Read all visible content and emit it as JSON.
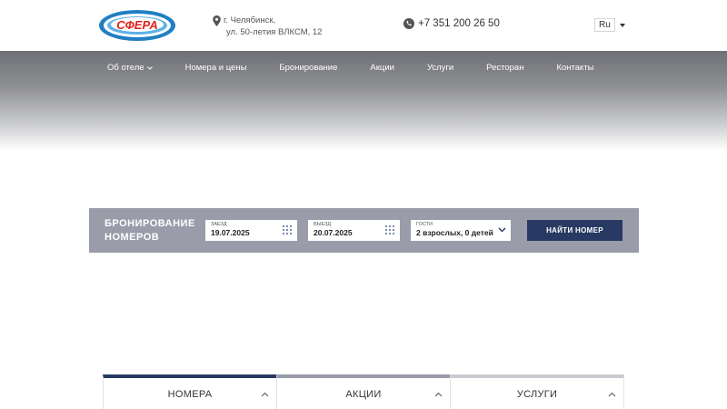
{
  "header": {
    "logo_text": "СФЕРА",
    "address_line1": "г. Челябинск,",
    "address_line2": "ул. 50-летия ВЛКСМ, 12",
    "phone": "+7 351 200 26 50",
    "language": "Ru"
  },
  "nav": {
    "items": [
      {
        "label": "Об отеле"
      },
      {
        "label": "Номера и цены"
      },
      {
        "label": "Бронирование"
      },
      {
        "label": "Акции"
      },
      {
        "label": "Услуги"
      },
      {
        "label": "Ресторан"
      },
      {
        "label": "Контакты"
      }
    ]
  },
  "booking": {
    "title_line1": "БРОНИРОВАНИЕ",
    "title_line2": "НОМЕРОВ",
    "checkin_label": "ЗАЕЗД",
    "checkin_value": "19.07.2025",
    "checkout_label": "ВЫЕЗД",
    "checkout_value": "20.07.2025",
    "guests_label": "ГОСТИ",
    "guests_value": "2 взрослых, 0 детей",
    "search_label": "НАЙТИ НОМЕР"
  },
  "tabs": [
    {
      "label": "НОМЕРА"
    },
    {
      "label": "АКЦИИ"
    },
    {
      "label": "УСЛУГИ"
    }
  ],
  "colors": {
    "accent": "#283a63",
    "booking_bg": "#9a9caa",
    "logo_red": "#e2231a",
    "logo_blue": "#1f7fc2"
  }
}
